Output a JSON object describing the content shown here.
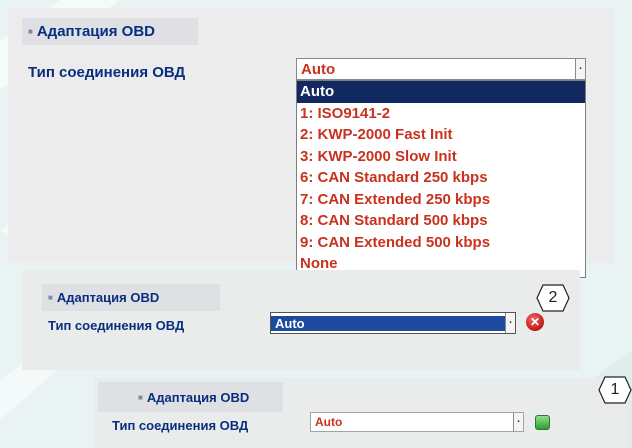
{
  "panel_large": {
    "header_title": "Адаптация OBD",
    "connection_label": "Тип соединения ОВД",
    "select_value": "Auto",
    "options": [
      "Auto",
      "1: ISO9141-2",
      "2: KWP-2000 Fast Init",
      "3: KWP-2000 Slow Init",
      "6: CAN Standard 250 kbps",
      "7: CAN Extended 250 kbps",
      "8: CAN Standard 500 kbps",
      "9: CAN Extended 500 kbps",
      "None"
    ],
    "selected_option_index": 0
  },
  "panel_middle": {
    "header_title": "Адаптация OBD",
    "connection_label": "Тип соединения ОВД",
    "select_value": "Auto",
    "status_icon": "error-x-icon",
    "callout": "2"
  },
  "panel_small": {
    "header_title": "Адаптация OBD",
    "connection_label": "Тип соединения ОВД",
    "select_value": "Auto",
    "status_icon": "ok-green-icon",
    "callout": "1"
  },
  "colors": {
    "title_blue": "#0a2e7f",
    "option_red": "#c8321e",
    "selected_bg": "#112860"
  }
}
